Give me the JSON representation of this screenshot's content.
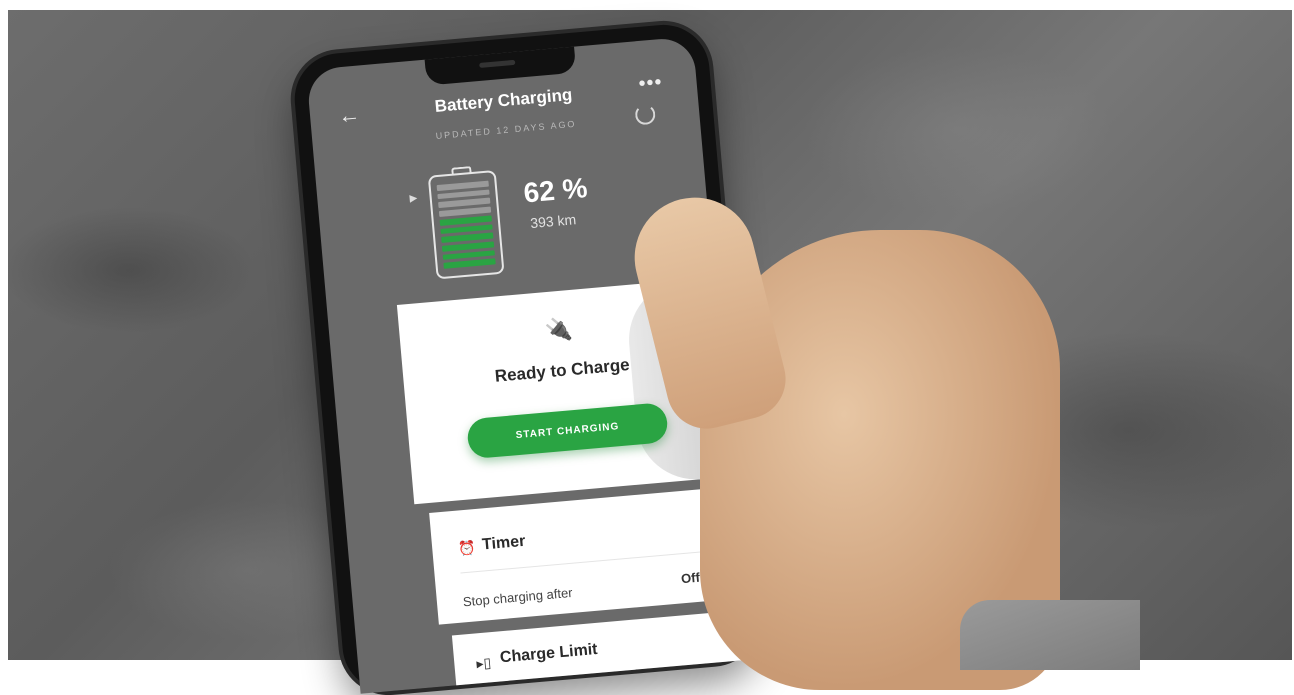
{
  "header": {
    "back_icon": "arrow-left-icon",
    "title": "Battery Charging",
    "more_icon": "more-horizontal-icon",
    "updated": "UPDATED 12 DAYS AGO",
    "refresh_icon": "refresh-icon"
  },
  "battery": {
    "level_percent": 62,
    "percent_label": "62 %",
    "range": "393 km",
    "fill_color": "#2aa443",
    "empty_color": "#9a9a9a"
  },
  "charge_card": {
    "icon": "plug-icon",
    "status": "Ready to Charge",
    "button": "START CHARGING",
    "accent": "#2aa443"
  },
  "timer_card": {
    "icon": "alarm-clock-icon",
    "title": "Timer",
    "row_label": "Stop charging after",
    "row_value": "Off",
    "chevron_icon": "chevron-right-icon"
  },
  "limit_card": {
    "icon": "battery-limit-icon",
    "title": "Charge Limit"
  }
}
